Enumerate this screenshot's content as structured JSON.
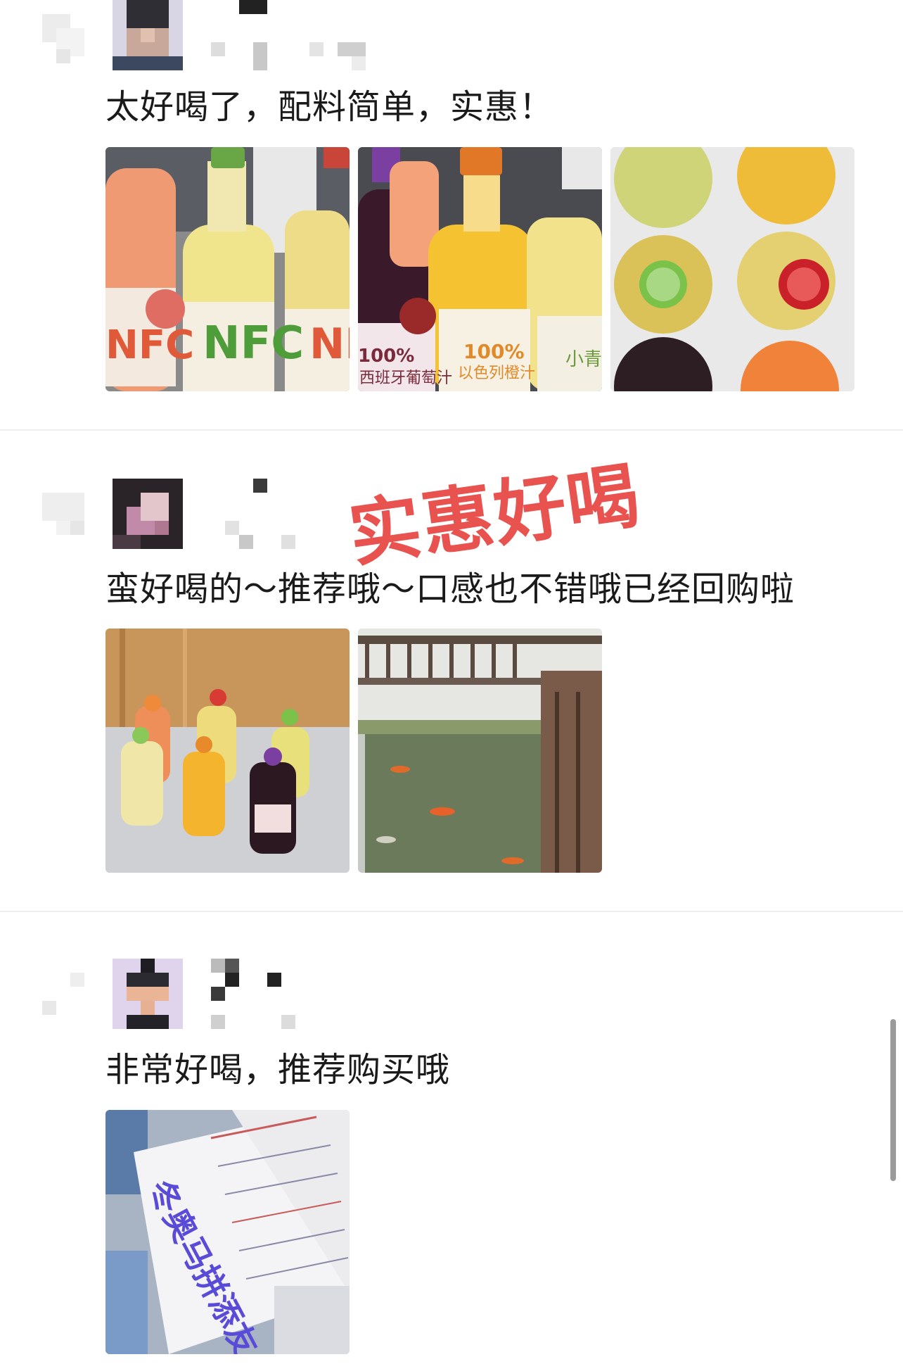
{
  "reviews": [
    {
      "text": "太好喝了，配料简单，实惠！",
      "photo_count": 3
    },
    {
      "text": "蛮好喝的～推荐哦～口感也不错哦已经回购啦",
      "photo_count": 2
    },
    {
      "text": "非常好喝，推荐购买哦",
      "photo_count": 1
    }
  ],
  "overlay": {
    "stamp_text": "实惠好喝"
  },
  "photo_labels": {
    "bottle1_brand": "NFC",
    "bottle2_brand": "NFC",
    "bottle3_brand": "NF",
    "label_100_grape": "100%",
    "label_100_orange": "100%",
    "orange_juice": "以色列橙汁",
    "red_grape": "西班牙葡萄汁",
    "green_lime": "小青柠",
    "note_handwriting": "冬奥马拼添友"
  },
  "colors": {
    "stamp": "#e8524f",
    "text": "#1a1a1a",
    "divider": "#eeeeee"
  }
}
